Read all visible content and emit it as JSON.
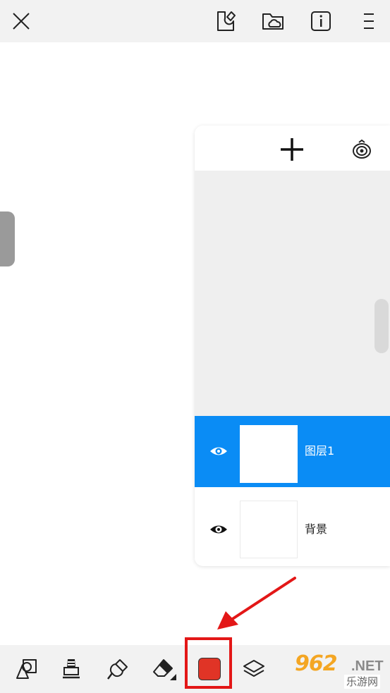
{
  "layers_panel": {
    "layers": [
      {
        "name": "图层1",
        "selected": true,
        "visible": true
      },
      {
        "name": "背景",
        "selected": false,
        "visible": true
      }
    ]
  },
  "toolbar": {
    "selected_color": "#e03426",
    "tools": [
      "shape-icon",
      "stamp-icon",
      "brush-icon",
      "eraser-icon",
      "color-swatch",
      "layers-icon"
    ]
  },
  "watermark": {
    "number": "962",
    "domain": ".NET",
    "site_name": "乐游网"
  },
  "colors": {
    "accent": "#0a8cf5",
    "highlight": "#e31717",
    "bar_bg": "#f2f2f2"
  }
}
